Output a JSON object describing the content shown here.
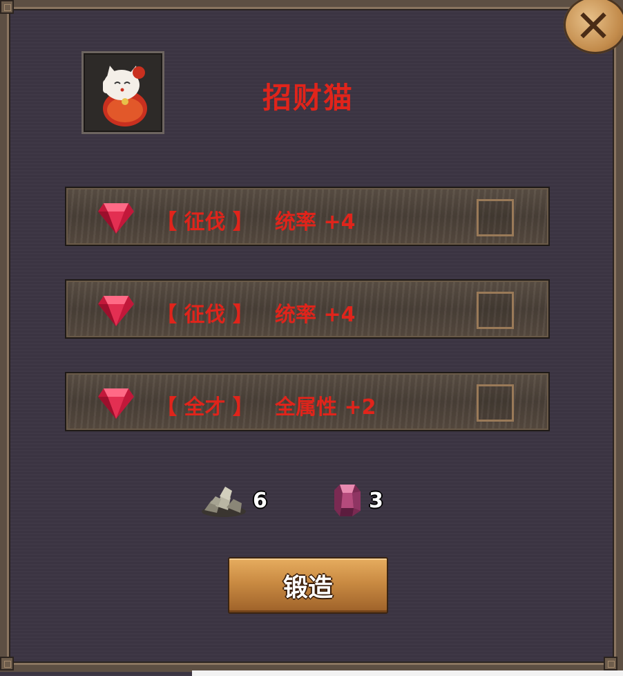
{
  "title": "招财猫",
  "close_icon": "close-x-icon",
  "item": {
    "icon": "lucky-cat-icon"
  },
  "attributes": [
    {
      "tag": "【 征伐 】",
      "stat": "统率 +4",
      "icon": "red-gem-icon",
      "checked": false
    },
    {
      "tag": "【 征伐 】",
      "stat": "统率 +4",
      "icon": "red-gem-icon",
      "checked": false
    },
    {
      "tag": "【 全才 】",
      "stat": "全属性 +2",
      "icon": "red-gem-icon",
      "checked": false
    }
  ],
  "costs": [
    {
      "icon": "ore-pile-icon",
      "amount": "6"
    },
    {
      "icon": "crystal-icon",
      "amount": "3"
    }
  ],
  "forge_button": {
    "label": "锻造"
  },
  "colors": {
    "title": "#e0241b",
    "attribute_text": "#e0241b",
    "panel_bg": "#3c3543",
    "button": "#c98a42"
  }
}
